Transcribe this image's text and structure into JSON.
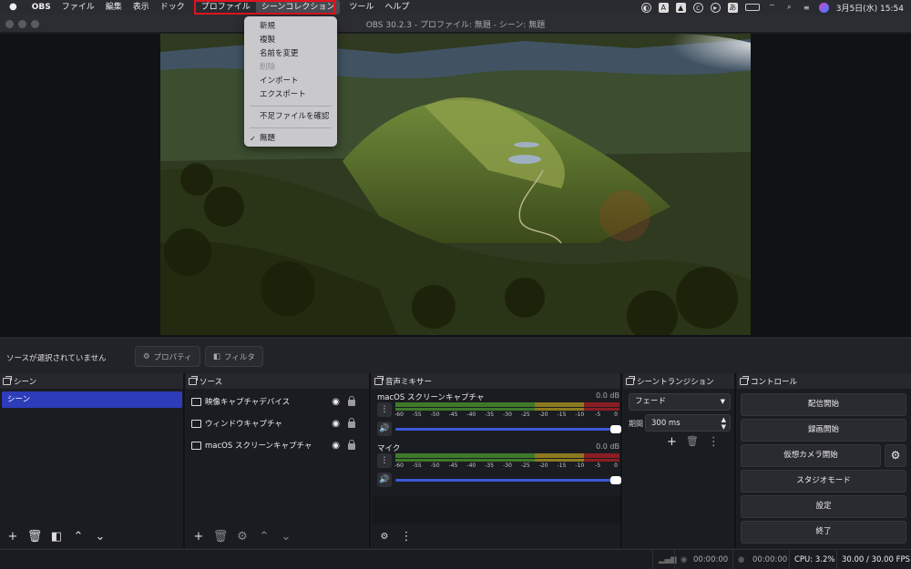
{
  "menubar": {
    "app": "OBS",
    "items": [
      "ファイル",
      "編集",
      "表示",
      "ドック",
      "プロファイル",
      "シーンコレクション",
      "ツール",
      "ヘルプ"
    ],
    "input_mode": "あ",
    "clock": "3月5日(水)  15:54"
  },
  "window": {
    "title": "OBS 30.2.3 - プロファイル: 無題 - シーン: 無題"
  },
  "dropdown": {
    "items": [
      {
        "label": "新規",
        "disabled": false
      },
      {
        "label": "複製",
        "disabled": false
      },
      {
        "label": "名前を変更",
        "disabled": false
      },
      {
        "label": "削除",
        "disabled": true
      },
      {
        "label": "インポート",
        "disabled": false
      },
      {
        "label": "エクスポート",
        "disabled": false
      },
      {
        "label": "不足ファイルを確認",
        "disabled": false
      },
      {
        "label": "無題",
        "disabled": false,
        "checked": true
      }
    ],
    "highlight_color": "#e0141e"
  },
  "source_toolbar": {
    "no_source_text": "ソースが選択されていません",
    "properties_label": "プロパティ",
    "filters_label": "フィルタ"
  },
  "scenes": {
    "title": "シーン",
    "items": [
      "シーン"
    ],
    "accent": "#2d3cb8"
  },
  "sources": {
    "title": "ソース",
    "items": [
      "映像キャプチャデバイス",
      "ウィンドウキャプチャ",
      "macOS スクリーンキャプチャ"
    ]
  },
  "mixer": {
    "title": "音声ミキサー",
    "scale": [
      "-60",
      "-55",
      "-50",
      "-45",
      "-40",
      "-35",
      "-30",
      "-25",
      "-20",
      "-15",
      "-10",
      "-5",
      "0"
    ],
    "channels": [
      {
        "name": "macOS スクリーンキャプチャ",
        "db": "0.0 dB",
        "volume": 1.0
      },
      {
        "name": "マイク",
        "db": "0.0 dB",
        "volume": 1.0
      }
    ]
  },
  "transitions": {
    "title": "シーントランジション",
    "selected": "フェード",
    "duration_label": "期間",
    "duration_value": "300 ms"
  },
  "controls": {
    "title": "コントロール",
    "buttons": [
      "配信開始",
      "録画開始",
      "仮想カメラ開始",
      "スタジオモード",
      "設定",
      "終了"
    ]
  },
  "status": {
    "stream_time": "00:00:00",
    "rec_time": "00:00:00",
    "cpu": "CPU: 3.2%",
    "fps": "30.00 / 30.00 FPS"
  }
}
